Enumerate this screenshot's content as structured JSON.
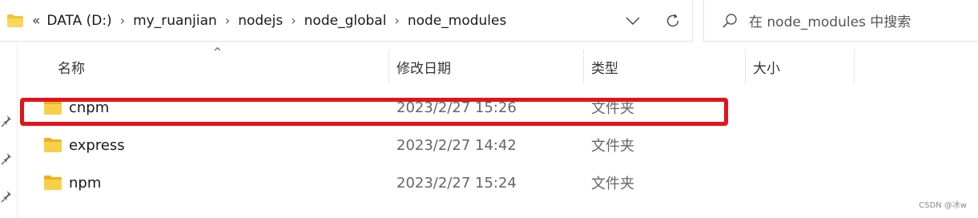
{
  "address_bar": {
    "overflow_chevron": "«",
    "breadcrumbs": [
      "DATA (D:)",
      "my_ruanjian",
      "nodejs",
      "node_global",
      "node_modules"
    ],
    "separator": "›"
  },
  "search": {
    "placeholder": "在 node_modules 中搜索"
  },
  "columns": {
    "name": "名称",
    "modified": "修改日期",
    "type": "类型",
    "size": "大小"
  },
  "files": [
    {
      "name": "cnpm",
      "modified": "2023/2/27 15:26",
      "type": "文件夹",
      "highlighted": true
    },
    {
      "name": "express",
      "modified": "2023/2/27 14:42",
      "type": "文件夹",
      "highlighted": false
    },
    {
      "name": "npm",
      "modified": "2023/2/27 15:24",
      "type": "文件夹",
      "highlighted": false
    }
  ],
  "watermark": "CSDN @冰w",
  "colors": {
    "highlight_border": "#e3131b",
    "folder_yellow": "#f5c232"
  },
  "icons": [
    "folder-icon",
    "dropdown-chevron-icon",
    "refresh-icon",
    "search-icon",
    "pin-icon",
    "sort-caret-icon"
  ]
}
